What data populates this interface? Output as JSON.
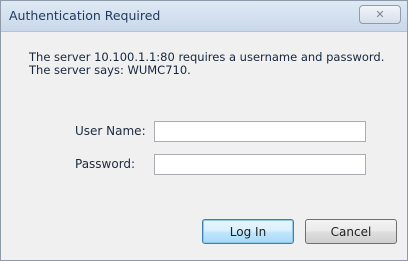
{
  "window": {
    "title": "Authentication Required",
    "close_label": "✕"
  },
  "message": {
    "line1": "The server 10.100.1.1:80 requires a username and password.",
    "line2": "The server says: WUMC710."
  },
  "form": {
    "username_label": "User Name:",
    "username_value": "",
    "password_label": "Password:",
    "password_value": ""
  },
  "buttons": {
    "login_label": "Log In",
    "cancel_label": "Cancel"
  },
  "colors": {
    "titlebar": "#c9d8ea",
    "title_text": "#1e395b",
    "default_button_border": "#3c7fb1"
  },
  "icons": {
    "close": "close-icon"
  }
}
